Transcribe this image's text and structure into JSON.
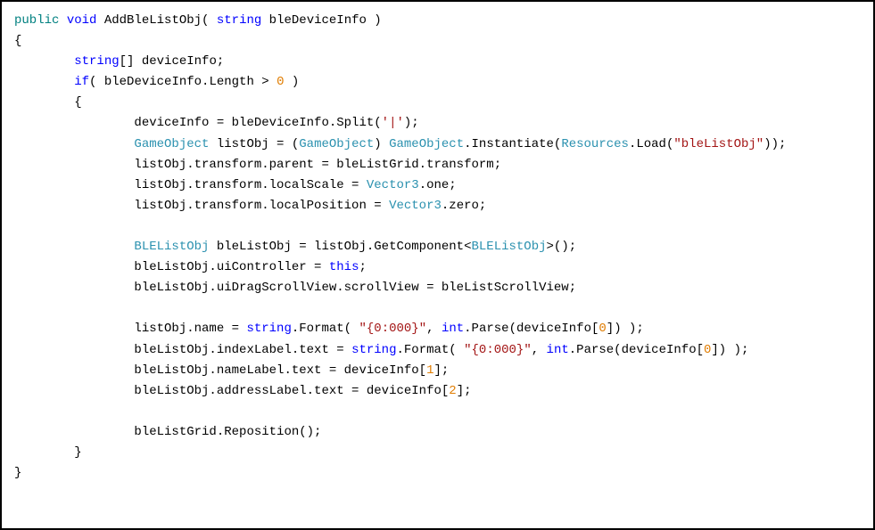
{
  "code": {
    "t_public": "public",
    "t_void": "void",
    "t_AddBleListObj": " AddBleListObj( ",
    "t_string": "string",
    "t_bleDeviceInfo_param": " bleDeviceInfo )",
    "t_lbrace1": "{",
    "t_indent1": "        ",
    "t_stringArr": "[] deviceInfo;",
    "t_if": "if",
    "t_ifcond_a": "( bleDeviceInfo.Length > ",
    "t_zero": "0",
    "t_ifcond_b": " )",
    "t_lbrace2": "        {",
    "t_indent2": "                ",
    "t_split_a": "deviceInfo = bleDeviceInfo.Split(",
    "t_pipe": "'|'",
    "t_split_b": ");",
    "t_GameObject": "GameObject",
    "t_listObj_decl": " listObj = (",
    "t_cast_close": ") ",
    "t_inst": ".Instantiate(",
    "t_Resources": "Resources",
    "t_load": ".Load(",
    "t_strBleListObj": "\"bleListObj\"",
    "t_close2": "));",
    "t_parent": "listObj.transform.parent = bleListGrid.transform;",
    "t_localScale_a": "listObj.transform.localScale = ",
    "t_Vector3": "Vector3",
    "t_one": ".one;",
    "t_localPos_a": "listObj.transform.localPosition = ",
    "t_zeroV": ".zero;",
    "t_BLEListObj": "BLEListObj",
    "t_getcomp_a": " bleListObj = listObj.GetComponent<",
    "t_getcomp_b": ">();",
    "t_uiCtrl_a": "bleListObj.uiController = ",
    "t_this": "this",
    "t_semi": ";",
    "t_scroll": "bleListObj.uiDragScrollView.scrollView = bleListScrollView;",
    "t_name_a": "listObj.name = ",
    "t_format": ".Format( ",
    "t_fmtStr": "\"{0:000}\"",
    "t_comma": ", ",
    "t_int": "int",
    "t_parse_a": ".Parse(deviceInfo[",
    "t_idx0": "0",
    "t_parse_b": "]) );",
    "t_idxLabel_a": "bleListObj.indexLabel.text = ",
    "t_nameLabel_a": "bleListObj.nameLabel.text = deviceInfo[",
    "t_idx1": "1",
    "t_brClose": "];",
    "t_addrLabel_a": "bleListObj.addressLabel.text = deviceInfo[",
    "t_idx2": "2",
    "t_repos": "bleListGrid.Reposition();",
    "t_rbrace2": "        }",
    "t_rbrace1": "}"
  }
}
